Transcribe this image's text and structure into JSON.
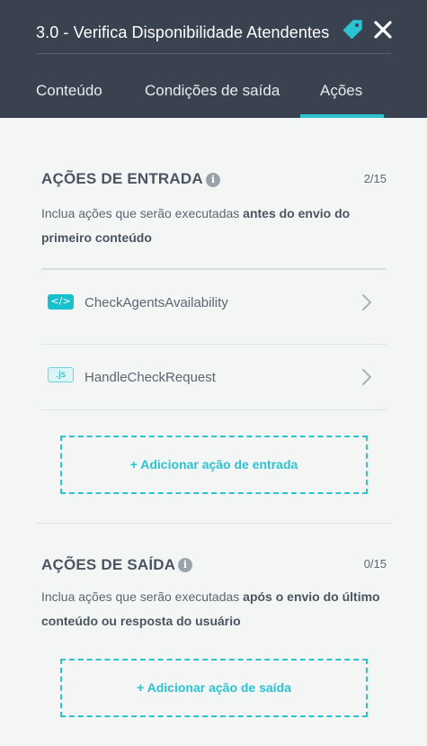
{
  "header": {
    "title": "3.0 - Verifica Disponibilidade Atendentes",
    "tabs": [
      {
        "label": "Conteúdo"
      },
      {
        "label": "Condições de saída"
      },
      {
        "label": "Ações",
        "active": true
      }
    ],
    "accent_color": "#2cc3d1",
    "icons": {
      "tag": "tag-icon",
      "close": "close-icon"
    }
  },
  "entry_actions": {
    "title": "AÇÕES DE ENTRADA",
    "count": "2/15",
    "description_prefix": "Inclua ações que serão executadas ",
    "description_bold": "antes do envio do primeiro conteúdo",
    "items": [
      {
        "badge": "</>",
        "badge_icon": "code-icon",
        "label": "CheckAgentsAvailability"
      },
      {
        "badge": ".js",
        "badge_icon": "js-icon",
        "label": "HandleCheckRequest"
      }
    ],
    "add_label": "+ Adicionar ação de entrada"
  },
  "exit_actions": {
    "title": "AÇÕES DE SAÍDA",
    "count": "0/15",
    "description_prefix": "Inclua ações que serão executadas ",
    "description_bold": "após o envio do último conteúdo ou resposta do usuário",
    "add_label": "+ Adicionar ação de saída"
  }
}
